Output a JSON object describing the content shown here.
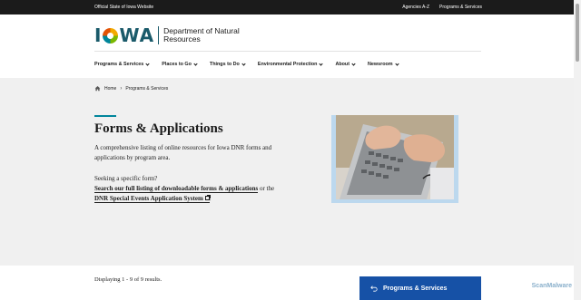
{
  "topbar": {
    "official": "Official State of Iowa Website",
    "links": [
      "Agencies A-Z",
      "Programs & Services"
    ]
  },
  "logo": {
    "word_left": "I",
    "word_right": "WA",
    "dept_line1": "Department of Natural",
    "dept_line2": "Resources",
    "colors": [
      "#f2a900",
      "#7ab800",
      "#00859b",
      "#e35205"
    ]
  },
  "nav": [
    {
      "label": "Programs & Services"
    },
    {
      "label": "Places to Go"
    },
    {
      "label": "Things to Do"
    },
    {
      "label": "Environmental Protection"
    },
    {
      "label": "About"
    },
    {
      "label": "Newsroom"
    }
  ],
  "breadcrumb": {
    "home": "Home",
    "sep": "›",
    "current": "Programs & Services"
  },
  "hero": {
    "title": "Forms & Applications",
    "intro": "A comprehensive listing of online resources for Iowa DNR forms and applications by program area.",
    "seek_prefix": "Seeking a specific form?",
    "link1": "Search our full listing of downloadable forms & applications",
    "link_mid": " or the",
    "link2": "DNR Special Events Application System",
    "link_end": "."
  },
  "results": "Displaying 1 - 9 of 9 results.",
  "programs_button": "Programs & Services",
  "watermark": "ScanMalware"
}
